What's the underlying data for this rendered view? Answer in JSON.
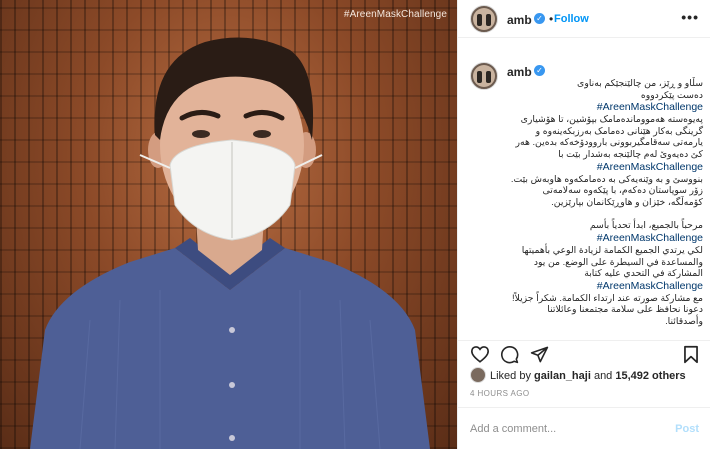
{
  "photo": {
    "hashtag_overlay": "#AreenMaskChallenge"
  },
  "header": {
    "username": "amb",
    "verified_mark": "✓",
    "separator": "•",
    "follow_label": "Follow",
    "more_label": "•••"
  },
  "caption": {
    "username": "amb",
    "lines": [
      "سڵاو و ڕێز، من چالێنجێکم بەناوی",
      "دەست پێکردووە",
      "#AreenMaskChallenge",
      "پەیوەستە هەمووماندەمامک بپۆشین، تا هۆشیاری گرینگی بەکار هێنانی دەمامک بەرزبکەینەوە و یارمەتی سەقامگیربوونی باروودۆخەکە بدەین. هەر کێ دەیەوێ لەم چالێنجە بەشدار بێت با",
      "#AreenMaskChallenge",
      "بنووسێ و بە وێنەیەکی بە دەمامکەوە هاوبەش بێت. زۆر سوپاستان دەکەم، با پێکەوە سەلامەتی کۆمەڵگە، خێزان و هاوڕێکانمان بپارێزین.",
      "مرحباً بالجميع، ابدأ تحدياً بأسم",
      "#AreenMaskChallenge",
      "لكي يرتدي الجميع الكمامة لزيادة الوعي بأهميتها والمساعدة في السيطرة على الوضع. من يود المشاركة في التحدي عليه كتابة",
      "#AreenMaskChallenge",
      "مع مشاركة صورته عند ارتداء الكمامة. شكراً جزيلاً! دعونا نحافظ على سلامة مجتمعنا وعائلاتنا وأصدقائنا."
    ]
  },
  "actions": {
    "like_icon": "heart-icon",
    "comment_icon": "comment-icon",
    "share_icon": "paper-plane-icon",
    "save_icon": "bookmark-icon"
  },
  "likes": {
    "prefix": "Liked by ",
    "user": "gailan_haji",
    "middle": " and ",
    "others": "15,492 others"
  },
  "timestamp": "4 HOURS AGO",
  "comment": {
    "placeholder": "Add a comment...",
    "post_label": "Post"
  },
  "colors": {
    "verified": "#3897f0",
    "follow": "#0095f6",
    "hashtag": "#00376b",
    "post_disabled": "#b2dffc"
  }
}
